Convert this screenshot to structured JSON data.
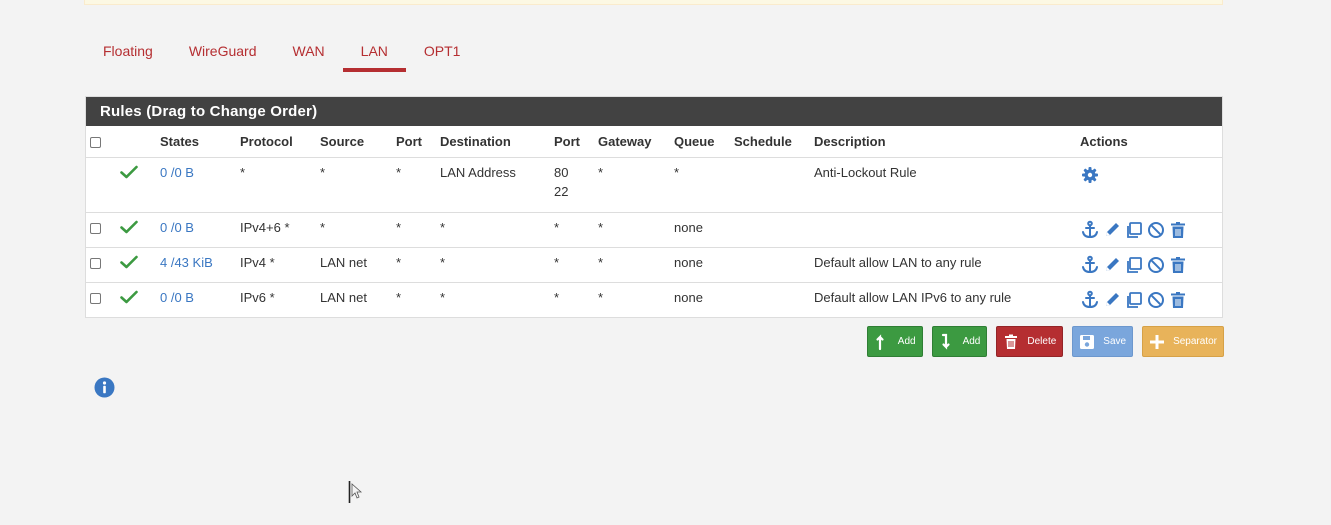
{
  "tabs": [
    {
      "label": "Floating"
    },
    {
      "label": "WireGuard"
    },
    {
      "label": "WAN"
    },
    {
      "label": "LAN",
      "active": true
    },
    {
      "label": "OPT1"
    }
  ],
  "panel": {
    "title": "Rules (Drag to Change Order)",
    "columns": [
      "",
      "",
      "States",
      "Protocol",
      "Source",
      "Port",
      "Destination",
      "Port",
      "Gateway",
      "Queue",
      "Schedule",
      "Description",
      "Actions"
    ],
    "rows": [
      {
        "states": "0 /0 B",
        "protocol": "*",
        "source": "*",
        "src_port": "*",
        "destination": "LAN Address",
        "dst_port_1": "80",
        "dst_port_2": "22",
        "gateway": "*",
        "queue": "*",
        "schedule": "",
        "description": "Anti-Lockout Rule"
      },
      {
        "states": "0 /0 B",
        "protocol": "IPv4+6 *",
        "source": "*",
        "src_port": "*",
        "destination": "*",
        "dst_port": "*",
        "gateway": "*",
        "queue": "none",
        "schedule": "",
        "description": ""
      },
      {
        "states": "4 /43 KiB",
        "protocol": "IPv4 *",
        "source": "LAN net",
        "src_port": "*",
        "destination": "*",
        "dst_port": "*",
        "gateway": "*",
        "queue": "none",
        "schedule": "",
        "description": "Default allow LAN to any rule"
      },
      {
        "states": "0 /0 B",
        "protocol": "IPv6 *",
        "source": "LAN net",
        "src_port": "*",
        "destination": "*",
        "dst_port": "*",
        "gateway": "*",
        "queue": "none",
        "schedule": "",
        "description": "Default allow LAN IPv6 to any rule"
      }
    ]
  },
  "buttons": {
    "add_top": "Add",
    "add_bottom": "Add",
    "delete": "Delete",
    "save": "Save",
    "separator": "Separator"
  },
  "colors": {
    "tab_accent": "#b52e31",
    "link": "#3a77c2",
    "pass": "#3c9a41",
    "header_bg": "#424242"
  },
  "icons": {
    "pass": "check-icon",
    "settings": "gear-icon",
    "actions": [
      "anchor-icon",
      "pencil-icon",
      "copy-icon",
      "disable-icon",
      "trash-icon"
    ],
    "info": "info-icon"
  }
}
